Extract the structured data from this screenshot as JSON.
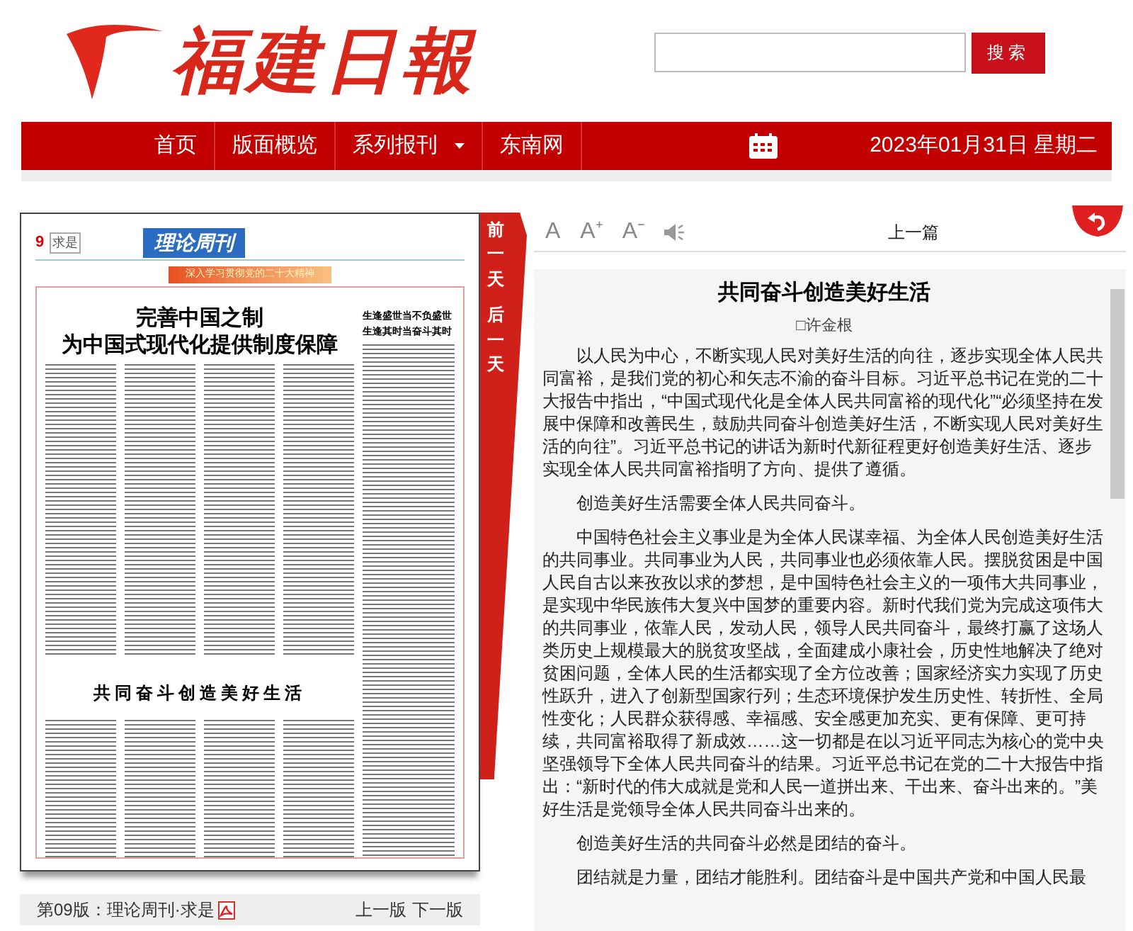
{
  "header": {
    "logo": "福建日報",
    "search_button": "搜索"
  },
  "nav": {
    "items": [
      {
        "label": "首页",
        "dropdown": false
      },
      {
        "label": "版面概览",
        "dropdown": false
      },
      {
        "label": "系列报刊",
        "dropdown": true
      },
      {
        "label": "东南网",
        "dropdown": false
      }
    ],
    "date": "2023年01月31日 星期二"
  },
  "page_scan": {
    "page_number": "9",
    "section": "求是",
    "masthead": "理论周刊",
    "banner": "深入学习贯彻党的二十大精神",
    "headlines": [
      {
        "kind": "main",
        "lines": [
          "完善中国之制",
          "为中国式现代化提供制度保障"
        ]
      },
      {
        "kind": "side",
        "lines": [
          "生逢盛世当不负盛世",
          "生逢其时当奋斗其时"
        ]
      },
      {
        "kind": "lower",
        "lines": [
          "共同奋斗创造美好生活"
        ]
      }
    ]
  },
  "day_tabs": [
    "前一天",
    "后一天"
  ],
  "page_footer": {
    "label": "第09版：理论周刊·求是",
    "prev": "上一版",
    "next": "下一版"
  },
  "toolbar": {
    "font_buttons": [
      "A",
      "A⁺",
      "A⁻"
    ],
    "prev_article": "上一篇"
  },
  "article": {
    "title": "共同奋斗创造美好生活",
    "author": "□许金根",
    "paragraphs": [
      "以人民为中心，不断实现人民对美好生活的向往，逐步实现全体人民共同富裕，是我们党的初心和矢志不渝的奋斗目标。习近平总书记在党的二十大报告中指出，“中国式现代化是全体人民共同富裕的现代化”“必须坚持在发展中保障和改善民生，鼓励共同奋斗创造美好生活，不断实现人民对美好生活的向往”。习近平总书记的讲话为新时代新征程更好创造美好生活、逐步实现全体人民共同富裕指明了方向、提供了遵循。",
      "创造美好生活需要全体人民共同奋斗。",
      "中国特色社会主义事业是为全体人民谋幸福、为全体人民创造美好生活的共同事业。共同事业为人民，共同事业也必须依靠人民。摆脱贫困是中国人民自古以来孜孜以求的梦想，是中国特色社会主义的一项伟大共同事业，是实现中华民族伟大复兴中国梦的重要内容。新时代我们党为完成这项伟大的共同事业，依靠人民，发动人民，领导人民共同奋斗，最终打赢了这场人类历史上规模最大的脱贫攻坚战，全面建成小康社会，历史性地解决了绝对贫困问题，全体人民的生活都实现了全方位改善；国家经济实力实现了历史性跃升，进入了创新型国家行列；生态环境保护发生历史性、转折性、全局性变化；人民群众获得感、幸福感、安全感更加充实、更有保障、更可持续，共同富裕取得了新成效……这一切都是在以习近平同志为核心的党中央坚强领导下全体人民共同奋斗的结果。习近平总书记在党的二十大报告中指出：“新时代的伟大成就是党和人民一道拼出来、干出来、奋斗出来的。”美好生活是党领导全体人民共同奋斗出来的。",
      "创造美好生活的共同奋斗必然是团结的奋斗。",
      "团结就是力量，团结才能胜利。团结奋斗是中国共产党和中国人民最"
    ]
  }
}
